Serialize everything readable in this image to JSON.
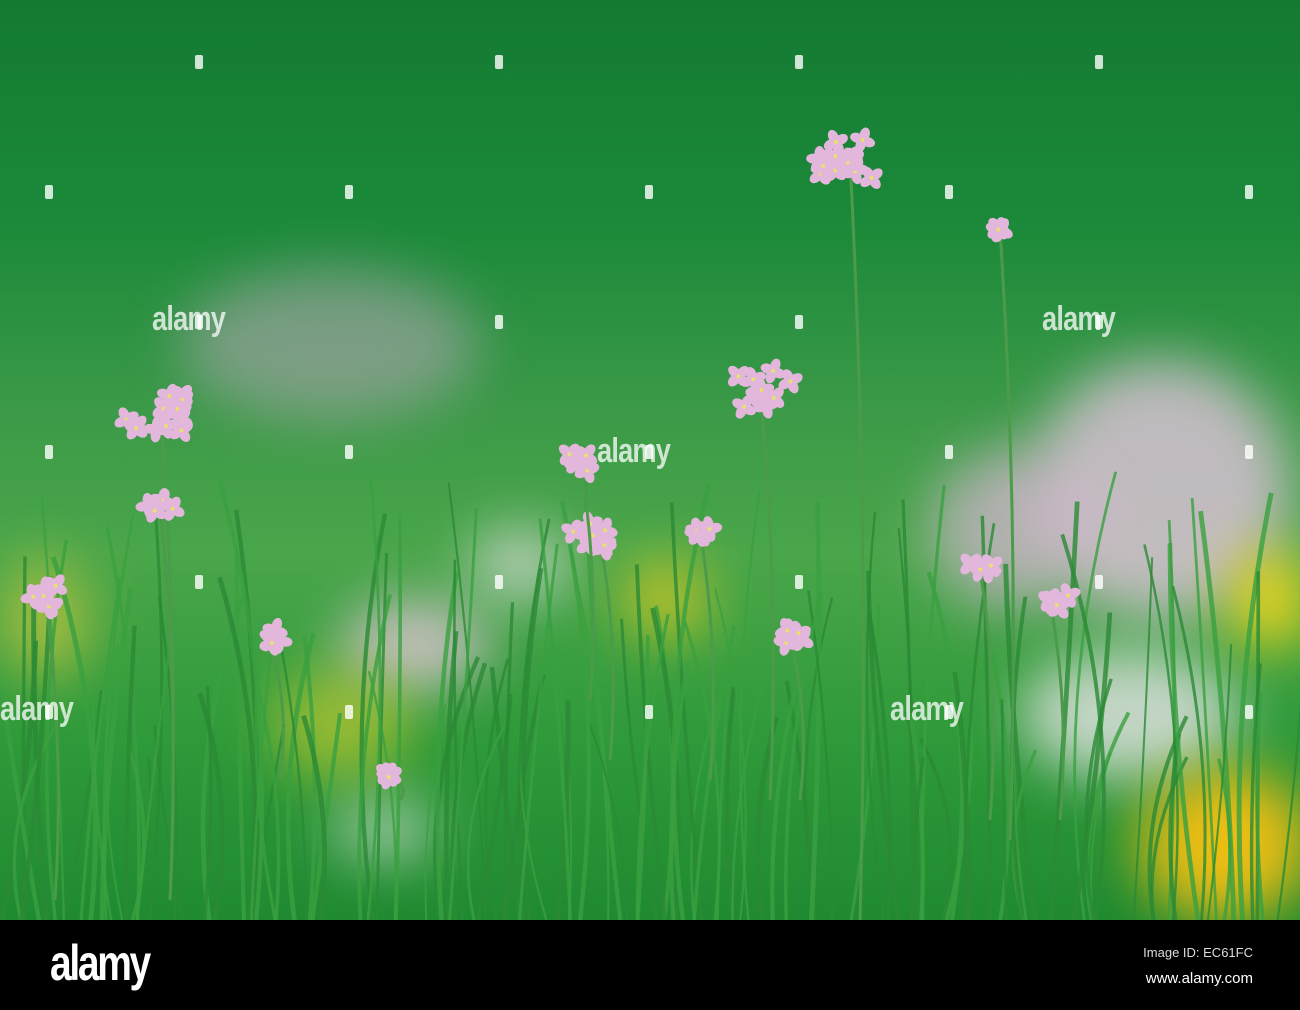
{
  "photo": {
    "subject": "Cuckooflower meadow",
    "colors": {
      "background_green": "#1c8a3a",
      "flower_pink": "#e3b6dc",
      "dandelion_yellow": "#f4d21a"
    }
  },
  "watermark": {
    "text": "alamy"
  },
  "footer": {
    "logo": "alamy",
    "image_id": "Image ID: EC61FC",
    "url": "www.alamy.com"
  }
}
